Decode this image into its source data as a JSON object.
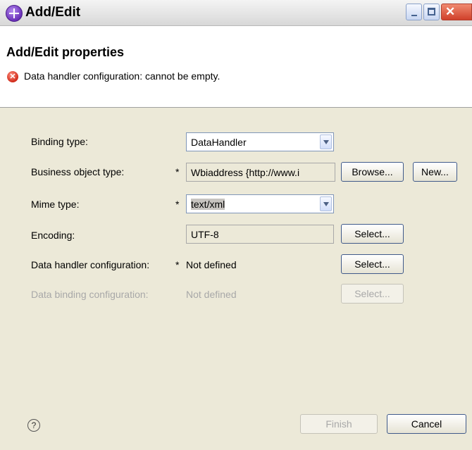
{
  "window": {
    "title": "Add/Edit",
    "icon": "app-icon",
    "controls": [
      "minimize-icon",
      "maximize-icon",
      "close-icon"
    ]
  },
  "header": {
    "title": "Add/Edit properties",
    "error_icon": "error-icon",
    "error_message": "Data handler configuration: cannot be empty."
  },
  "form": {
    "binding_type": {
      "label": "Binding type:",
      "value": "DataHandler"
    },
    "business_object_type": {
      "label": "Business object type:",
      "required": "*",
      "value": "Wbiaddress  {http://www.i",
      "browse_label": "Browse...",
      "new_label": "New..."
    },
    "mime_type": {
      "label": "Mime type:",
      "required": "*",
      "value": "text/xml"
    },
    "encoding": {
      "label": "Encoding:",
      "value": "UTF-8",
      "select_label": "Select..."
    },
    "data_handler_config": {
      "label": "Data handler configuration:",
      "required": "*",
      "value": "Not defined",
      "select_label": "Select..."
    },
    "data_binding_config": {
      "label": "Data binding configuration:",
      "value": "Not defined",
      "select_label": "Select..."
    }
  },
  "footer": {
    "help_icon": "help-icon",
    "finish_label": "Finish",
    "cancel_label": "Cancel"
  },
  "colors": {
    "dialog_bg": "#ece9d8",
    "header_bg": "#ffffff",
    "error_red": "#d02a1a",
    "disabled_text": "#a8a8a8",
    "close_button": "#d0402a"
  }
}
